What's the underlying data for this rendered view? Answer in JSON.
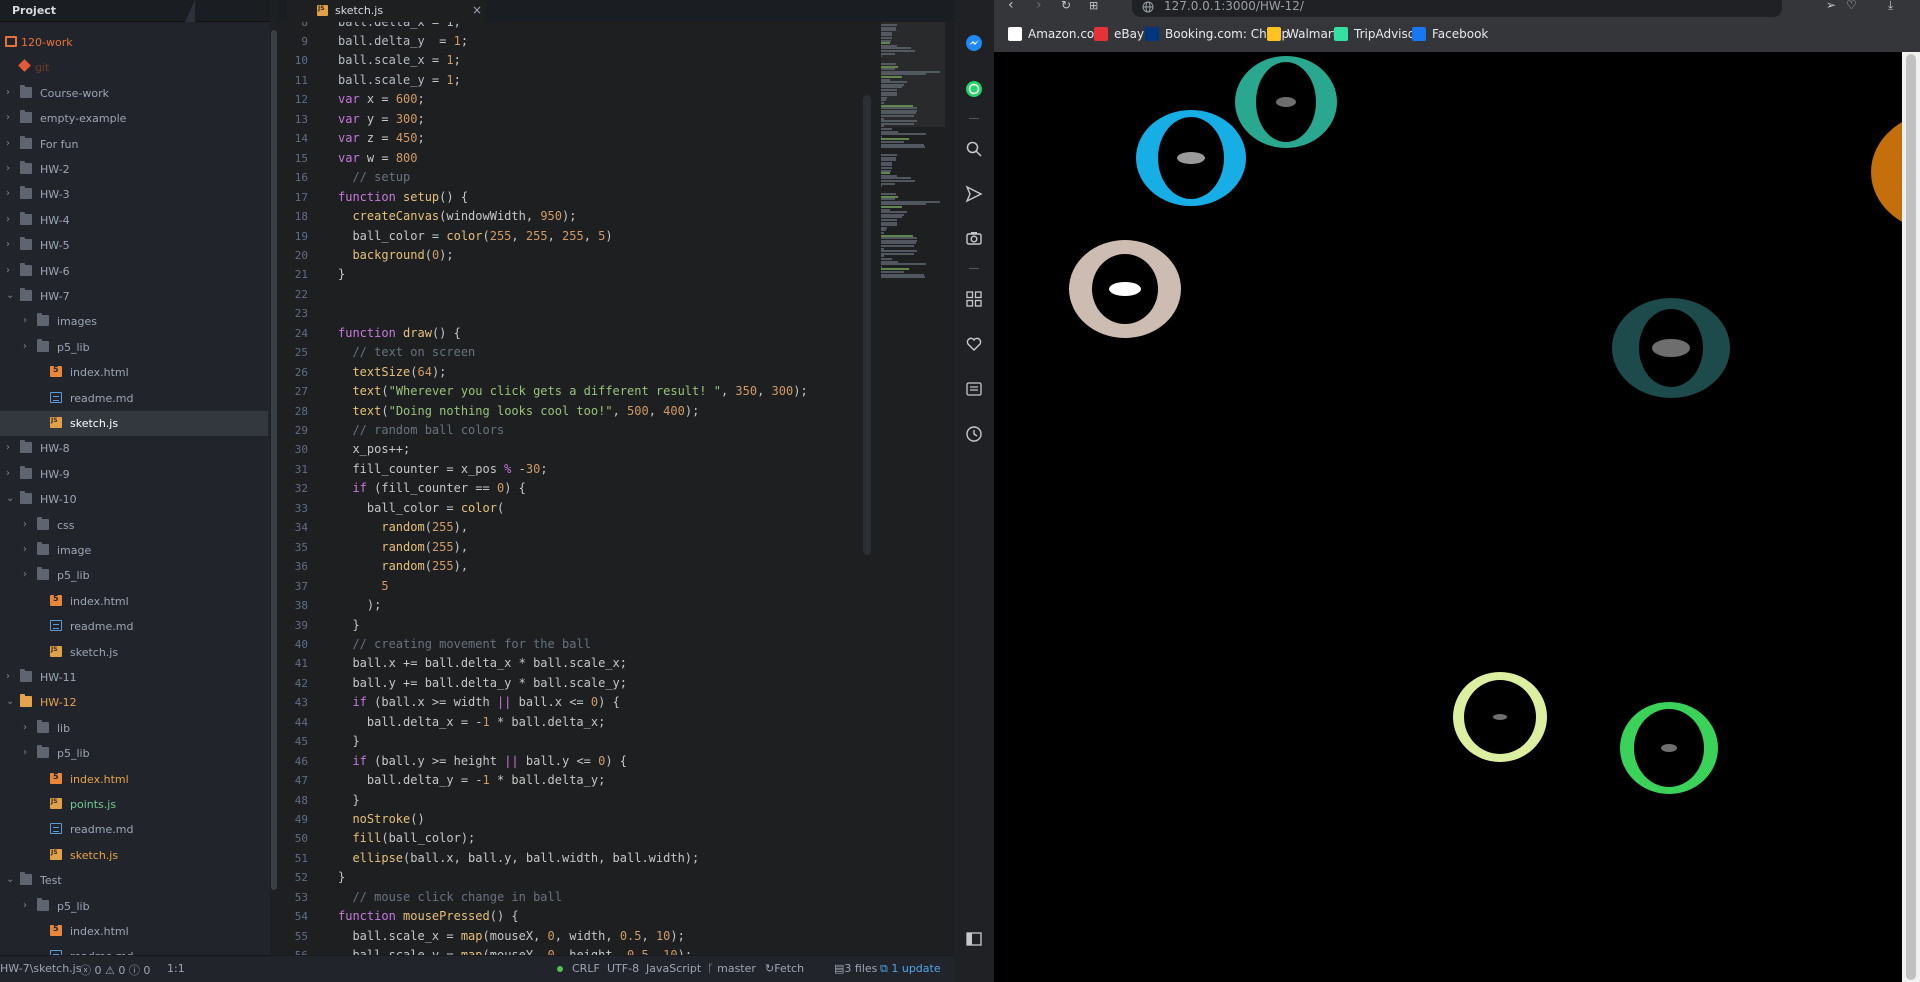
{
  "tree": {
    "header": "Project",
    "items": [
      {
        "label": "120-work",
        "type": "repo",
        "depth": 0,
        "expanded": true,
        "color": "#e5733b"
      },
      {
        "label": "git",
        "type": "git",
        "depth": 1,
        "color": "#6b3a2e"
      },
      {
        "label": "Course-work",
        "type": "folder",
        "depth": 0,
        "expanded": false
      },
      {
        "label": "empty-example",
        "type": "folder",
        "depth": 0,
        "expanded": false
      },
      {
        "label": "For fun",
        "type": "folder",
        "depth": 0,
        "expanded": false
      },
      {
        "label": "HW-2",
        "type": "folder",
        "depth": 0,
        "expanded": false
      },
      {
        "label": "HW-3",
        "type": "folder",
        "depth": 0,
        "expanded": false
      },
      {
        "label": "HW-4",
        "type": "folder",
        "depth": 0,
        "expanded": false
      },
      {
        "label": "HW-5",
        "type": "folder",
        "depth": 0,
        "expanded": false
      },
      {
        "label": "HW-6",
        "type": "folder",
        "depth": 0,
        "expanded": false
      },
      {
        "label": "HW-7",
        "type": "folder",
        "depth": 0,
        "expanded": true
      },
      {
        "label": "images",
        "type": "folder",
        "depth": 1,
        "expanded": false
      },
      {
        "label": "p5_lib",
        "type": "folder",
        "depth": 1,
        "expanded": false
      },
      {
        "label": "index.html",
        "type": "html",
        "depth": 1
      },
      {
        "label": "readme.md",
        "type": "md",
        "depth": 1
      },
      {
        "label": "sketch.js",
        "type": "js",
        "depth": 1,
        "selected": true,
        "color": "#ffffff"
      },
      {
        "label": "HW-8",
        "type": "folder",
        "depth": 0,
        "expanded": false
      },
      {
        "label": "HW-9",
        "type": "folder",
        "depth": 0,
        "expanded": false
      },
      {
        "label": "HW-10",
        "type": "folder",
        "depth": 0,
        "expanded": true
      },
      {
        "label": "css",
        "type": "folder",
        "depth": 1,
        "expanded": false
      },
      {
        "label": "image",
        "type": "folder",
        "depth": 1,
        "expanded": false
      },
      {
        "label": "p5_lib",
        "type": "folder",
        "depth": 1,
        "expanded": false
      },
      {
        "label": "index.html",
        "type": "html",
        "depth": 1
      },
      {
        "label": "readme.md",
        "type": "md",
        "depth": 1
      },
      {
        "label": "sketch.js",
        "type": "js",
        "depth": 1
      },
      {
        "label": "HW-11",
        "type": "folder",
        "depth": 0,
        "expanded": false
      },
      {
        "label": "HW-12",
        "type": "folder",
        "depth": 0,
        "expanded": true,
        "highlight": true,
        "color": "#e5a44b"
      },
      {
        "label": "lib",
        "type": "folder",
        "depth": 1,
        "expanded": false
      },
      {
        "label": "p5_lib",
        "type": "folder",
        "depth": 1,
        "expanded": false
      },
      {
        "label": "index.html",
        "type": "html",
        "depth": 1,
        "color": "#e5a44b"
      },
      {
        "label": "points.js",
        "type": "js",
        "depth": 1,
        "color": "#73c990"
      },
      {
        "label": "readme.md",
        "type": "md",
        "depth": 1
      },
      {
        "label": "sketch.js",
        "type": "js",
        "depth": 1,
        "color": "#e5a44b"
      },
      {
        "label": "Test",
        "type": "folder",
        "depth": 0,
        "expanded": true
      },
      {
        "label": "p5_lib",
        "type": "folder",
        "depth": 1,
        "expanded": false
      },
      {
        "label": "index.html",
        "type": "html",
        "depth": 1
      },
      {
        "label": "readme.md",
        "type": "md",
        "depth": 1
      }
    ]
  },
  "editor": {
    "tab_label": "sketch.js",
    "tab_close": "×",
    "first_line_partial": {
      "n": "8",
      "text": "ball.delta_x = 1;"
    },
    "lines": [
      {
        "n": "9",
        "t": [
          [
            "prop",
            "ball.delta_y"
          ],
          [
            "",
            "  = "
          ],
          [
            "num",
            "1"
          ],
          [
            "",
            ";"
          ]
        ]
      },
      {
        "n": "10",
        "t": [
          [
            "prop",
            "ball.scale_x"
          ],
          [
            "",
            " = "
          ],
          [
            "num",
            "1"
          ],
          [
            "",
            ";"
          ]
        ]
      },
      {
        "n": "11",
        "t": [
          [
            "prop",
            "ball.scale_y"
          ],
          [
            "",
            " = "
          ],
          [
            "num",
            "1"
          ],
          [
            "",
            ";"
          ]
        ]
      },
      {
        "n": "12",
        "t": [
          [
            "kw",
            "var"
          ],
          [
            "",
            " x = "
          ],
          [
            "num",
            "600"
          ],
          [
            "",
            ";"
          ]
        ]
      },
      {
        "n": "13",
        "t": [
          [
            "kw",
            "var"
          ],
          [
            "",
            " y = "
          ],
          [
            "num",
            "300"
          ],
          [
            "",
            ";"
          ]
        ]
      },
      {
        "n": "14",
        "t": [
          [
            "kw",
            "var"
          ],
          [
            "",
            " z = "
          ],
          [
            "num",
            "450"
          ],
          [
            "",
            ";"
          ]
        ]
      },
      {
        "n": "15",
        "t": [
          [
            "kw",
            "var"
          ],
          [
            "",
            " w = "
          ],
          [
            "num",
            "800"
          ]
        ]
      },
      {
        "n": "16",
        "t": [
          [
            "cm",
            "  // setup"
          ]
        ]
      },
      {
        "n": "17",
        "t": [
          [
            "kw",
            "function"
          ],
          [
            "",
            " "
          ],
          [
            "fn",
            "setup"
          ],
          [
            "",
            "() {"
          ]
        ]
      },
      {
        "n": "18",
        "t": [
          [
            "",
            "  "
          ],
          [
            "fn",
            "createCanvas"
          ],
          [
            "",
            "(windowWidth, "
          ],
          [
            "num",
            "950"
          ],
          [
            "",
            ");"
          ]
        ]
      },
      {
        "n": "19",
        "t": [
          [
            "",
            "  ball_color = "
          ],
          [
            "fn",
            "color"
          ],
          [
            "",
            "("
          ],
          [
            "num",
            "255"
          ],
          [
            "",
            ", "
          ],
          [
            "num",
            "255"
          ],
          [
            "",
            ", "
          ],
          [
            "num",
            "255"
          ],
          [
            "",
            ", "
          ],
          [
            "num",
            "5"
          ],
          [
            "",
            ")"
          ]
        ]
      },
      {
        "n": "20",
        "t": [
          [
            "",
            "  "
          ],
          [
            "fn",
            "background"
          ],
          [
            "",
            "("
          ],
          [
            "num",
            "0"
          ],
          [
            "",
            ");"
          ]
        ]
      },
      {
        "n": "21",
        "t": [
          [
            "",
            "}"
          ]
        ]
      },
      {
        "n": "22",
        "t": []
      },
      {
        "n": "23",
        "t": []
      },
      {
        "n": "24",
        "t": [
          [
            "kw",
            "function"
          ],
          [
            "",
            " "
          ],
          [
            "fn",
            "draw"
          ],
          [
            "",
            "() {"
          ]
        ]
      },
      {
        "n": "25",
        "t": [
          [
            "cm",
            "  // text on screen"
          ]
        ]
      },
      {
        "n": "26",
        "t": [
          [
            "",
            "  "
          ],
          [
            "fn",
            "textSize"
          ],
          [
            "",
            "("
          ],
          [
            "num",
            "64"
          ],
          [
            "",
            ");"
          ]
        ]
      },
      {
        "n": "27",
        "t": [
          [
            "",
            "  "
          ],
          [
            "fn",
            "text"
          ],
          [
            "",
            "("
          ],
          [
            "str",
            "\"Wherever you click gets a different result! \""
          ],
          [
            "",
            ", "
          ],
          [
            "num",
            "350"
          ],
          [
            "",
            ", "
          ],
          [
            "num",
            "300"
          ],
          [
            "",
            ");"
          ]
        ]
      },
      {
        "n": "28",
        "t": [
          [
            "",
            "  "
          ],
          [
            "fn",
            "text"
          ],
          [
            "",
            "("
          ],
          [
            "str",
            "\"Doing nothing looks cool too!\""
          ],
          [
            "",
            ", "
          ],
          [
            "num",
            "500"
          ],
          [
            "",
            ", "
          ],
          [
            "num",
            "400"
          ],
          [
            "",
            ");"
          ]
        ]
      },
      {
        "n": "29",
        "t": [
          [
            "cm",
            "  // random ball colors"
          ]
        ]
      },
      {
        "n": "30",
        "t": [
          [
            "",
            "  x_pos++;"
          ]
        ]
      },
      {
        "n": "31",
        "t": [
          [
            "",
            "  fill_counter = x_pos "
          ],
          [
            "kw",
            "%"
          ],
          [
            "",
            " -"
          ],
          [
            "num",
            "30"
          ],
          [
            "",
            ";"
          ]
        ]
      },
      {
        "n": "32",
        "t": [
          [
            "",
            "  "
          ],
          [
            "kw",
            "if"
          ],
          [
            "",
            " (fill_counter == "
          ],
          [
            "num",
            "0"
          ],
          [
            "",
            ") {"
          ]
        ]
      },
      {
        "n": "33",
        "t": [
          [
            "",
            "    ball_color = "
          ],
          [
            "fn",
            "color"
          ],
          [
            "",
            "("
          ]
        ]
      },
      {
        "n": "34",
        "t": [
          [
            "",
            "      "
          ],
          [
            "fn",
            "random"
          ],
          [
            "",
            "("
          ],
          [
            "num",
            "255"
          ],
          [
            "",
            "),"
          ]
        ]
      },
      {
        "n": "35",
        "t": [
          [
            "",
            "      "
          ],
          [
            "fn",
            "random"
          ],
          [
            "",
            "("
          ],
          [
            "num",
            "255"
          ],
          [
            "",
            "),"
          ]
        ]
      },
      {
        "n": "36",
        "t": [
          [
            "",
            "      "
          ],
          [
            "fn",
            "random"
          ],
          [
            "",
            "("
          ],
          [
            "num",
            "255"
          ],
          [
            "",
            "),"
          ]
        ]
      },
      {
        "n": "37",
        "t": [
          [
            "",
            "      "
          ],
          [
            "num",
            "5"
          ]
        ]
      },
      {
        "n": "38",
        "t": [
          [
            "",
            "    );"
          ]
        ]
      },
      {
        "n": "39",
        "t": [
          [
            "",
            "  }"
          ]
        ]
      },
      {
        "n": "40",
        "t": [
          [
            "cm",
            "  // creating movement for the ball"
          ]
        ]
      },
      {
        "n": "41",
        "t": [
          [
            "",
            "  ball.x += ball.delta_x * ball.scale_x;"
          ]
        ]
      },
      {
        "n": "42",
        "t": [
          [
            "",
            "  ball.y += ball.delta_y * ball.scale_y;"
          ]
        ]
      },
      {
        "n": "43",
        "t": [
          [
            "",
            "  "
          ],
          [
            "kw",
            "if"
          ],
          [
            "",
            " (ball.x >= width "
          ],
          [
            "kw",
            "||"
          ],
          [
            "",
            " ball.x <= "
          ],
          [
            "num",
            "0"
          ],
          [
            "",
            ") {"
          ]
        ]
      },
      {
        "n": "44",
        "t": [
          [
            "",
            "    ball.delta_x = -"
          ],
          [
            "num",
            "1"
          ],
          [
            "",
            " * ball.delta_x;"
          ]
        ]
      },
      {
        "n": "45",
        "t": [
          [
            "",
            "  }"
          ]
        ]
      },
      {
        "n": "46",
        "t": [
          [
            "",
            "  "
          ],
          [
            "kw",
            "if"
          ],
          [
            "",
            " (ball.y >= height "
          ],
          [
            "kw",
            "||"
          ],
          [
            "",
            " ball.y <= "
          ],
          [
            "num",
            "0"
          ],
          [
            "",
            ") {"
          ]
        ]
      },
      {
        "n": "47",
        "t": [
          [
            "",
            "    ball.delta_y = -"
          ],
          [
            "num",
            "1"
          ],
          [
            "",
            " * ball.delta_y;"
          ]
        ]
      },
      {
        "n": "48",
        "t": [
          [
            "",
            "  }"
          ]
        ]
      },
      {
        "n": "49",
        "t": [
          [
            "",
            "  "
          ],
          [
            "fn",
            "noStroke"
          ],
          [
            "",
            "()"
          ]
        ]
      },
      {
        "n": "50",
        "t": [
          [
            "",
            "  "
          ],
          [
            "fn",
            "fill"
          ],
          [
            "",
            "(ball_color);"
          ]
        ]
      },
      {
        "n": "51",
        "t": [
          [
            "",
            "  "
          ],
          [
            "fn",
            "ellipse"
          ],
          [
            "",
            "(ball.x, ball.y, ball.width, ball.width);"
          ]
        ]
      },
      {
        "n": "52",
        "t": [
          [
            "",
            "}"
          ]
        ]
      },
      {
        "n": "53",
        "t": [
          [
            "cm",
            "  // mouse click change in ball"
          ]
        ]
      },
      {
        "n": "54",
        "t": [
          [
            "kw",
            "function"
          ],
          [
            "",
            " "
          ],
          [
            "fn",
            "mousePressed"
          ],
          [
            "",
            "() {"
          ]
        ]
      },
      {
        "n": "55",
        "t": [
          [
            "",
            "  ball.scale_x = "
          ],
          [
            "fn",
            "map"
          ],
          [
            "",
            "(mouseX, "
          ],
          [
            "num",
            "0"
          ],
          [
            "",
            ", width, "
          ],
          [
            "num",
            "0.5"
          ],
          [
            "",
            ", "
          ],
          [
            "num",
            "10"
          ],
          [
            "",
            ");"
          ]
        ]
      },
      {
        "n": "56",
        "t": [
          [
            "",
            "  ball.scale_y = "
          ],
          [
            "fn",
            "map"
          ],
          [
            "",
            "(mouseY, "
          ],
          [
            "num",
            "0"
          ],
          [
            "",
            ", height, "
          ],
          [
            "num",
            "0.5"
          ],
          [
            "",
            ", "
          ],
          [
            "num",
            "10"
          ],
          [
            "",
            ");"
          ]
        ]
      }
    ]
  },
  "status": {
    "path": "HW-7\\sketch.js",
    "errors": "0",
    "warnings": "0",
    "infos": "0",
    "cursor": "1:1",
    "line_ending": "CRLF",
    "encoding": "UTF-8",
    "grammar": "JavaScript",
    "branch": "master",
    "fetch": "Fetch",
    "files": "3 files",
    "update": "1 update"
  },
  "browser": {
    "url": "127.0.0.1:3000/HW-12/",
    "bookmarks": [
      {
        "label": "Amazon.com",
        "color": "#ffffff"
      },
      {
        "label": "eBay",
        "color": "#e53238"
      },
      {
        "label": "Booking.com: Cheap",
        "color": "#003580"
      },
      {
        "label": "Walmart",
        "color": "#ffc220"
      },
      {
        "label": "TripAdvisor",
        "color": "#34e0a1"
      },
      {
        "label": "Facebook",
        "color": "#1877f2"
      }
    ],
    "canvas_background": "#000000",
    "rings": [
      {
        "color": "#29a88f",
        "inner": "#6e6e6e"
      },
      {
        "color": "#17aee6",
        "inner": "#9a9a9a"
      },
      {
        "color": "#cdbcb2",
        "inner": "#ffffff"
      },
      {
        "color": "#c46e0c",
        "inner": null
      },
      {
        "color": "#1d4a4a",
        "inner": "#6e6e6e"
      },
      {
        "color": "#dcefa0",
        "inner": "#6e6e6e"
      },
      {
        "color": "#3bd25a",
        "inner": "#6e6e6e"
      }
    ]
  },
  "icons": {
    "sidebar": [
      "messenger-icon",
      "whatsapp-icon",
      "search-icon",
      "send-icon",
      "camera-icon",
      "apps-icon",
      "heart-icon",
      "news-icon",
      "history-icon",
      "sidebar-toggle-icon"
    ]
  }
}
